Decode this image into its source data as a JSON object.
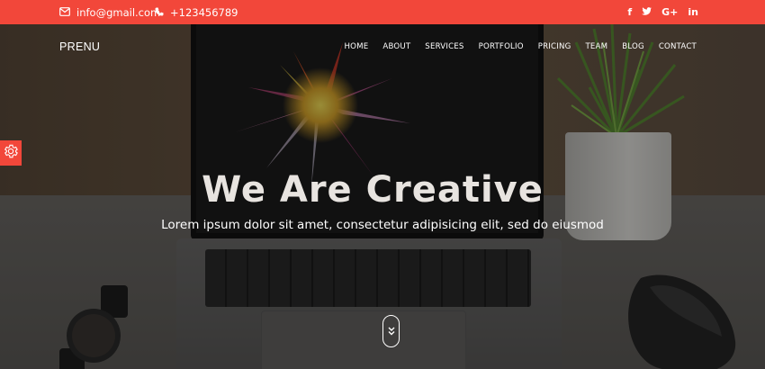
{
  "topbar": {
    "email": "info@gmail.com",
    "phone": "+123456789",
    "socials": [
      {
        "icon": "facebook-icon",
        "label": "f"
      },
      {
        "icon": "twitter-icon",
        "label": "t"
      },
      {
        "icon": "google-plus-icon",
        "label": "G+"
      },
      {
        "icon": "linkedin-icon",
        "label": "in"
      }
    ],
    "bg_color": "#f2473a"
  },
  "brand": "PRENU",
  "nav": {
    "items": [
      "HOME",
      "ABOUT",
      "SERVICES",
      "PORTFOLIO",
      "PRICING",
      "TEAM",
      "BLOG",
      "CONTACT"
    ]
  },
  "hero": {
    "title": "We Are Creative",
    "subtitle": "Lorem ipsum dolor sit amet, consectetur adipisicing elit, sed do eiusmod"
  },
  "icons": {
    "settings": "gear-icon",
    "scroll": "chevrons-down-icon"
  },
  "accent_color": "#f2473a"
}
